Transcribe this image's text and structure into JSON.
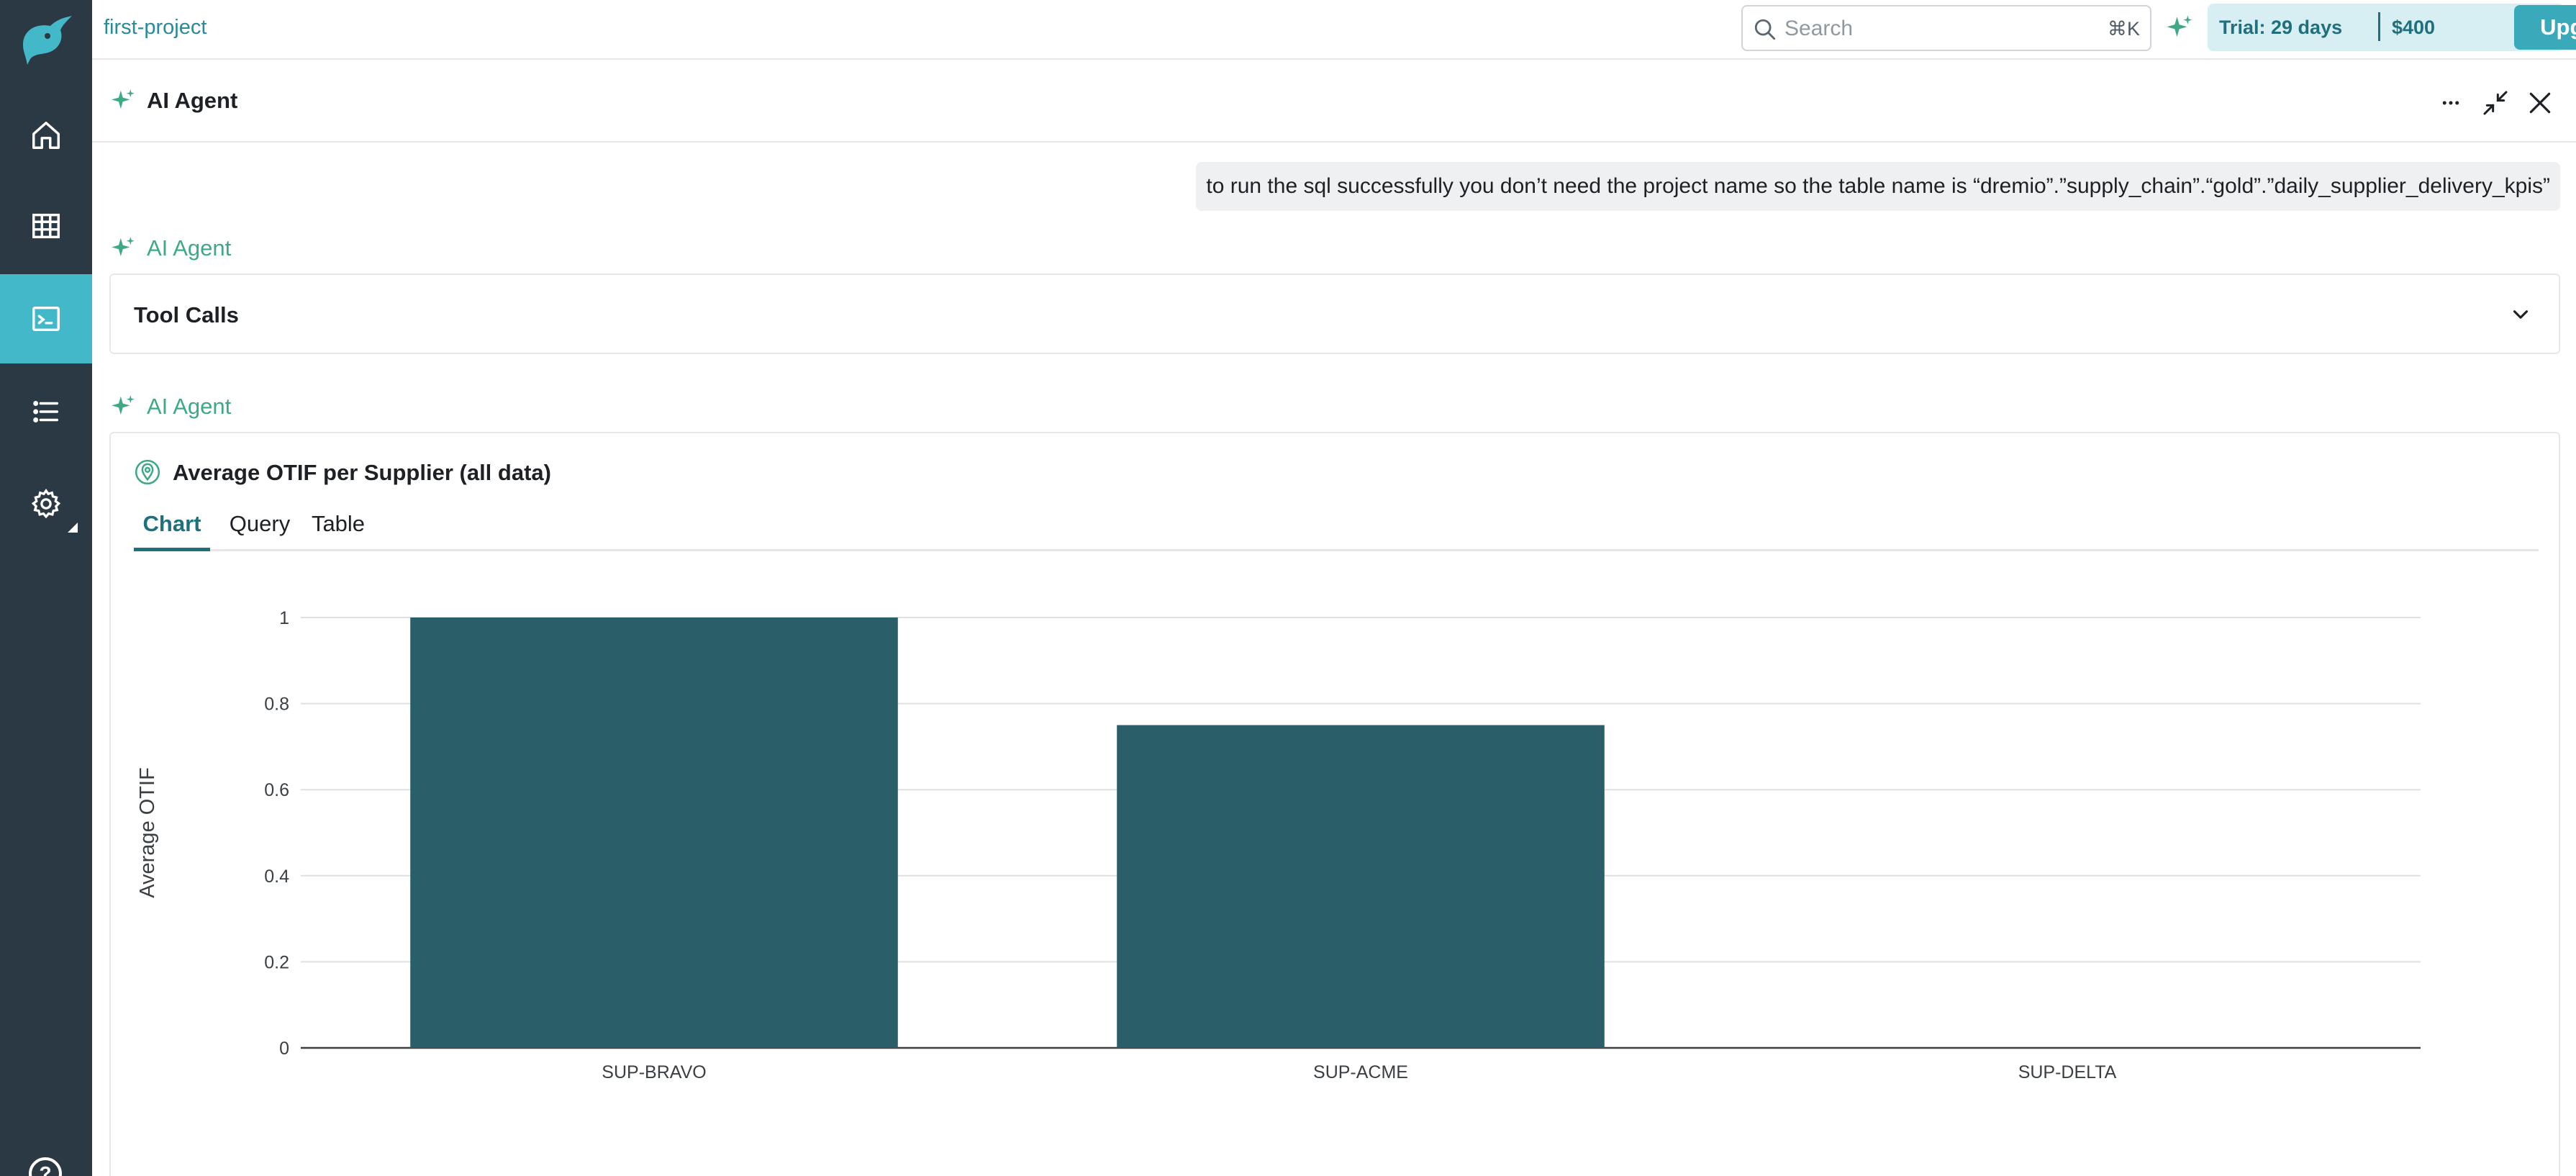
{
  "topbar": {
    "project_name": "first-project",
    "search_placeholder": "Search",
    "search_shortcut": "⌘K",
    "trial_days": "Trial: 29 days",
    "trial_amount": "$400",
    "upgrade_label": "Upgrade"
  },
  "sidebar": {
    "items": [
      {
        "icon": "home-icon"
      },
      {
        "icon": "table-grid-icon"
      },
      {
        "icon": "terminal-icon",
        "active": true
      },
      {
        "icon": "list-icon"
      },
      {
        "icon": "gear-icon"
      }
    ],
    "help_label": "?"
  },
  "panel": {
    "title": "AI Agent"
  },
  "conversation": {
    "user_message": "to run the sql successfully you don’t need the project name so the table name is “dremio”.”supply_chain”.“gold”.”daily_supplier_delivery_kpis”",
    "agent_label_1": "AI Agent",
    "tool_calls_label": "Tool Calls",
    "agent_label_2": "AI Agent"
  },
  "result_card": {
    "title": "Average OTIF per Supplier (all data)",
    "tabs": [
      "Chart",
      "Query",
      "Table"
    ],
    "active_tab": "Chart"
  },
  "colors": {
    "accent": "#43b8c9",
    "brand_dark": "#2a3943",
    "bar": "#2a5f69",
    "agent_green": "#3ea987"
  },
  "chart_data": {
    "type": "bar",
    "categories": [
      "SUP-BRAVO",
      "SUP-ACME",
      "SUP-DELTA"
    ],
    "values": [
      1,
      0.75,
      0
    ],
    "title": "",
    "xlabel": "",
    "ylabel": "Average OTIF",
    "ylim": [
      0,
      1
    ],
    "yticks": [
      "0",
      "0.2",
      "0.4",
      "0.6",
      "0.8",
      "1"
    ],
    "grid": true
  }
}
